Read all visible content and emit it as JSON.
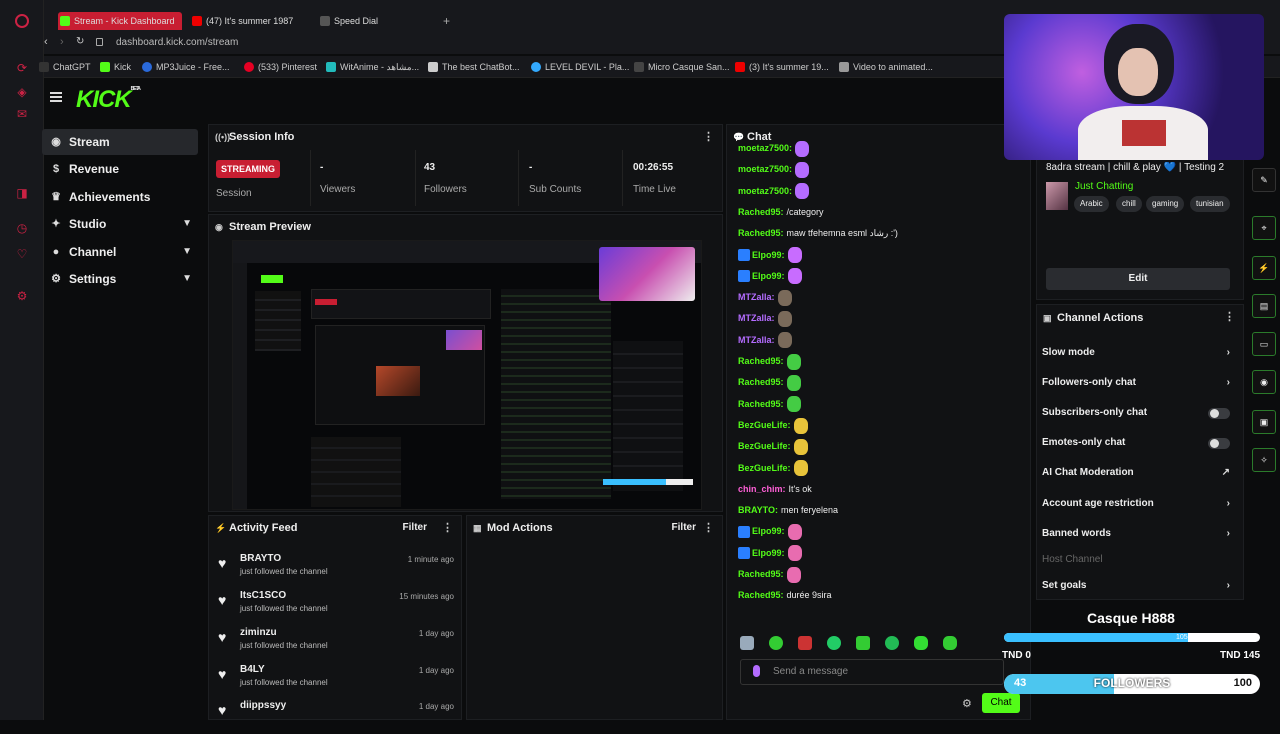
{
  "browser": {
    "tabs": [
      {
        "label": "Stream - Kick Dashboard",
        "active": true
      },
      {
        "label": "(47) It's summer 1987"
      },
      {
        "label": "Speed Dial"
      }
    ],
    "address": "dashboard.kick.com/stream",
    "bookmarks": [
      "ChatGPT",
      "Kick",
      "MP3Juice - Free...",
      "(533) Pinterest",
      "WitAnime - مشاهد...",
      "The best ChatBot...",
      "LEVEL DEVIL - Pla...",
      "Micro Casque San...",
      "(3) It's summer 19...",
      "Video to animated..."
    ]
  },
  "nav": {
    "logo": "KICK",
    "logo_tag": "BETA",
    "items": [
      {
        "label": "Stream",
        "icon": "broadcast-icon",
        "selected": true
      },
      {
        "label": "Revenue",
        "icon": "dollar-icon"
      },
      {
        "label": "Achievements",
        "icon": "trophy-icon"
      },
      {
        "label": "Studio",
        "icon": "studio-icon",
        "expandable": true
      },
      {
        "label": "Channel",
        "icon": "user-icon",
        "expandable": true
      },
      {
        "label": "Settings",
        "icon": "gear-icon",
        "expandable": true
      }
    ]
  },
  "session": {
    "title": "Session Info",
    "status": "STREAMING",
    "status_label": "Session",
    "stats": [
      {
        "value": "-",
        "label": "Viewers"
      },
      {
        "value": "43",
        "label": "Followers"
      },
      {
        "value": "-",
        "label": "Sub Counts"
      },
      {
        "value": "00:26:55",
        "label": "Time Live"
      }
    ]
  },
  "preview": {
    "title": "Stream Preview"
  },
  "activity": {
    "title": "Activity Feed",
    "filter": "Filter",
    "items": [
      {
        "name": "BRAYTO",
        "action": "just followed the channel",
        "time": "1 minute ago"
      },
      {
        "name": "ItsC1SCO",
        "action": "just followed the channel",
        "time": "15 minutes ago"
      },
      {
        "name": "ziminzu",
        "action": "just followed the channel",
        "time": "1 day ago"
      },
      {
        "name": "B4LY",
        "action": "just followed the channel",
        "time": "1 day ago"
      },
      {
        "name": "diippssyy",
        "action": "",
        "time": "1 day ago"
      }
    ]
  },
  "mod": {
    "title": "Mod Actions",
    "filter": "Filter"
  },
  "chat": {
    "title": "Chat",
    "placeholder": "Send a message",
    "send_label": "Chat",
    "messages": [
      {
        "user": "moetaz7500:",
        "text": "",
        "color": "#53fc18"
      },
      {
        "user": "moetaz7500:",
        "text": "",
        "color": "#53fc18"
      },
      {
        "user": "moetaz7500:",
        "text": "",
        "color": "#53fc18"
      },
      {
        "user": "Rached95:",
        "text": "/category",
        "color": "#53fc18"
      },
      {
        "user": "Rached95:",
        "text": "maw tfehemna esml رشاد :')",
        "color": "#53fc18"
      },
      {
        "user": "Elpo99:",
        "text": "",
        "color": "#53fc18"
      },
      {
        "user": "Elpo99:",
        "text": "",
        "color": "#53fc18"
      },
      {
        "user": "MTZalla:",
        "text": "",
        "color": "#b46cff"
      },
      {
        "user": "MTZalla:",
        "text": "",
        "color": "#b46cff"
      },
      {
        "user": "MTZalla:",
        "text": "",
        "color": "#b46cff"
      },
      {
        "user": "Rached95:",
        "text": "",
        "color": "#53fc18"
      },
      {
        "user": "Rached95:",
        "text": "",
        "color": "#53fc18"
      },
      {
        "user": "Rached95:",
        "text": "",
        "color": "#53fc18"
      },
      {
        "user": "BezGueLife:",
        "text": "",
        "color": "#53fc18"
      },
      {
        "user": "BezGueLife:",
        "text": "",
        "color": "#53fc18"
      },
      {
        "user": "BezGueLife:",
        "text": "",
        "color": "#53fc18"
      },
      {
        "user": "chin_chim:",
        "text": "It's ok",
        "color": "#ff5fd7"
      },
      {
        "user": "BRAYTO:",
        "text": "men feryelena",
        "color": "#53fc18"
      },
      {
        "user": "Elpo99:",
        "text": "",
        "color": "#53fc18"
      },
      {
        "user": "Elpo99:",
        "text": "",
        "color": "#53fc18"
      },
      {
        "user": "Rached95:",
        "text": "",
        "color": "#53fc18"
      },
      {
        "user": "Rached95:",
        "text": "durée 9sira",
        "color": "#53fc18"
      }
    ]
  },
  "stream_info": {
    "title": "8adra stream | chill & play 💙 | Testing 2",
    "category": "Just Chatting",
    "tags": [
      "Arabic",
      "chill",
      "gaming",
      "tunisian"
    ],
    "edit": "Edit"
  },
  "channel_actions": {
    "title": "Channel Actions",
    "items": [
      {
        "label": "Slow mode",
        "type": "arrow"
      },
      {
        "label": "Followers-only chat",
        "type": "arrow"
      },
      {
        "label": "Subscribers-only chat",
        "type": "toggle"
      },
      {
        "label": "Emotes-only chat",
        "type": "toggle"
      },
      {
        "label": "AI Chat Moderation",
        "type": "external"
      },
      {
        "label": "Account age restriction",
        "type": "arrow"
      },
      {
        "label": "Banned words",
        "type": "arrow"
      },
      {
        "label": "Host Channel",
        "type": "disabled"
      },
      {
        "label": "Set goals",
        "type": "arrow"
      }
    ]
  },
  "overlay": {
    "goal_title": "Casque H888",
    "goal_value": "105",
    "goal_min": "TND 0",
    "goal_max": "TND 145",
    "goal_fraction": 0.72,
    "followers_current": "43",
    "followers_label": "FOLLOWERS",
    "followers_target": "100",
    "followers_fraction": 0.43
  }
}
